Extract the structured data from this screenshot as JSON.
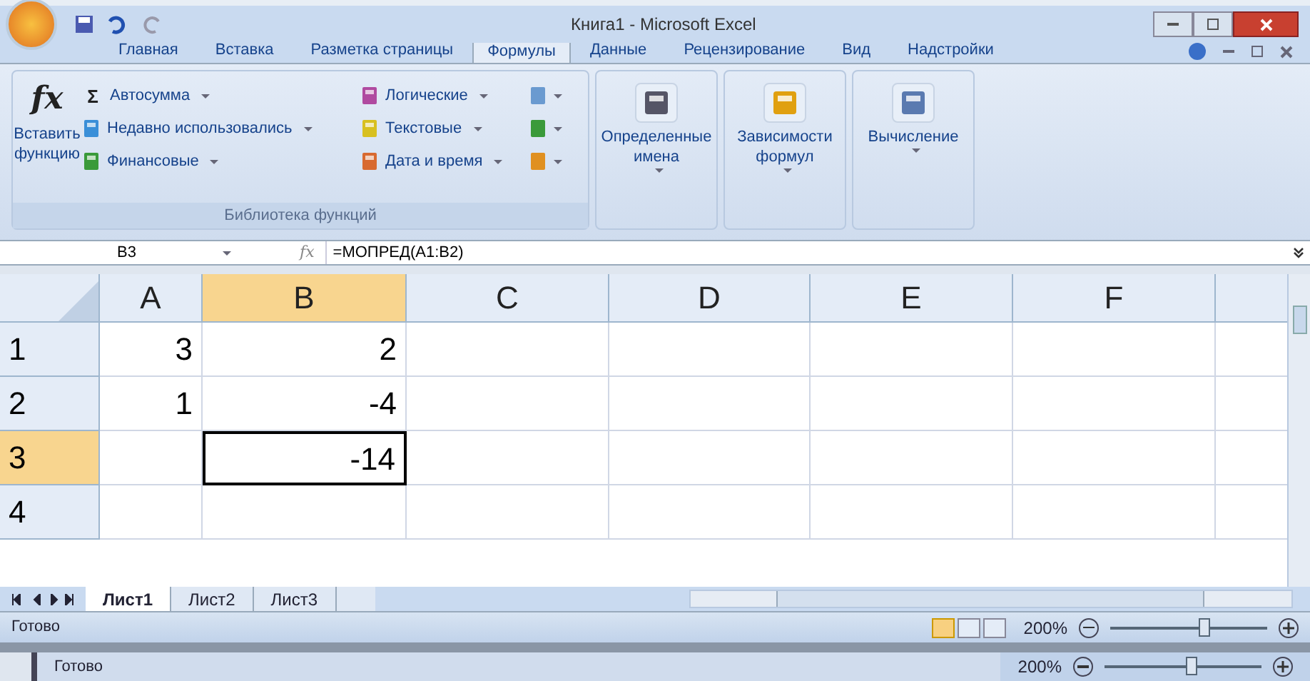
{
  "window": {
    "title": "Книга1 - Microsoft Excel"
  },
  "ribbon_tabs": [
    {
      "label": "Главная",
      "selected": false
    },
    {
      "label": "Вставка",
      "selected": false
    },
    {
      "label": "Разметка страницы",
      "selected": false
    },
    {
      "label": "Формулы",
      "selected": true
    },
    {
      "label": "Данные",
      "selected": false
    },
    {
      "label": "Рецензирование",
      "selected": false
    },
    {
      "label": "Вид",
      "selected": false
    },
    {
      "label": "Надстройки",
      "selected": false
    }
  ],
  "function_library": {
    "insert_function_icon": "fx",
    "insert_function": "Вставить функцию",
    "items": [
      {
        "label": "Автосумма",
        "kind": "sum",
        "symbol": "Σ"
      },
      {
        "label": "Недавно использовались",
        "kind": "recent"
      },
      {
        "label": "Финансовые",
        "kind": "finance"
      }
    ],
    "items2": [
      {
        "label": "Логические",
        "kind": "logic"
      },
      {
        "label": "Текстовые",
        "kind": "text"
      },
      {
        "label": "Дата и время",
        "kind": "date"
      }
    ],
    "group_label": "Библиотека функций"
  },
  "ribbon_groups": [
    {
      "label": "Определенные имена",
      "kind": "names"
    },
    {
      "label": "Зависимости формул",
      "kind": "audit"
    },
    {
      "label": "Вычисление",
      "kind": "calc"
    }
  ],
  "formula_bar": {
    "name_box": "B3",
    "fx_icon": "fx",
    "formula": "=МОПРЕД(A1:B2)"
  },
  "columns": [
    {
      "label": "A",
      "selected": false
    },
    {
      "label": "B",
      "selected": true
    },
    {
      "label": "C",
      "selected": false
    },
    {
      "label": "D",
      "selected": false
    },
    {
      "label": "E",
      "selected": false
    },
    {
      "label": "F",
      "selected": false
    }
  ],
  "rows": [
    {
      "label": "1",
      "selected": false,
      "cells": [
        {
          "text": "3",
          "active": false
        },
        {
          "text": "2",
          "active": false
        }
      ]
    },
    {
      "label": "2",
      "selected": false,
      "cells": [
        {
          "text": "1",
          "active": false
        },
        {
          "text": "-4",
          "active": false
        }
      ]
    },
    {
      "label": "3",
      "selected": true,
      "cells": [
        {
          "active": false
        },
        {
          "text": "-14",
          "active": true
        }
      ]
    },
    {
      "label": "4",
      "selected": false,
      "cells": [
        {
          "active": false
        },
        {
          "active": false
        }
      ]
    }
  ],
  "sheets": [
    {
      "label": "Лист1",
      "selected": true
    },
    {
      "label": "Лист2",
      "selected": false
    },
    {
      "label": "Лист3",
      "selected": false
    }
  ],
  "status_bar": {
    "status": "Готово",
    "zoom": "200%",
    "level": 0.6
  },
  "background_status_bar": {
    "status": "Готово",
    "zoom": "200%",
    "level": 0.55
  }
}
